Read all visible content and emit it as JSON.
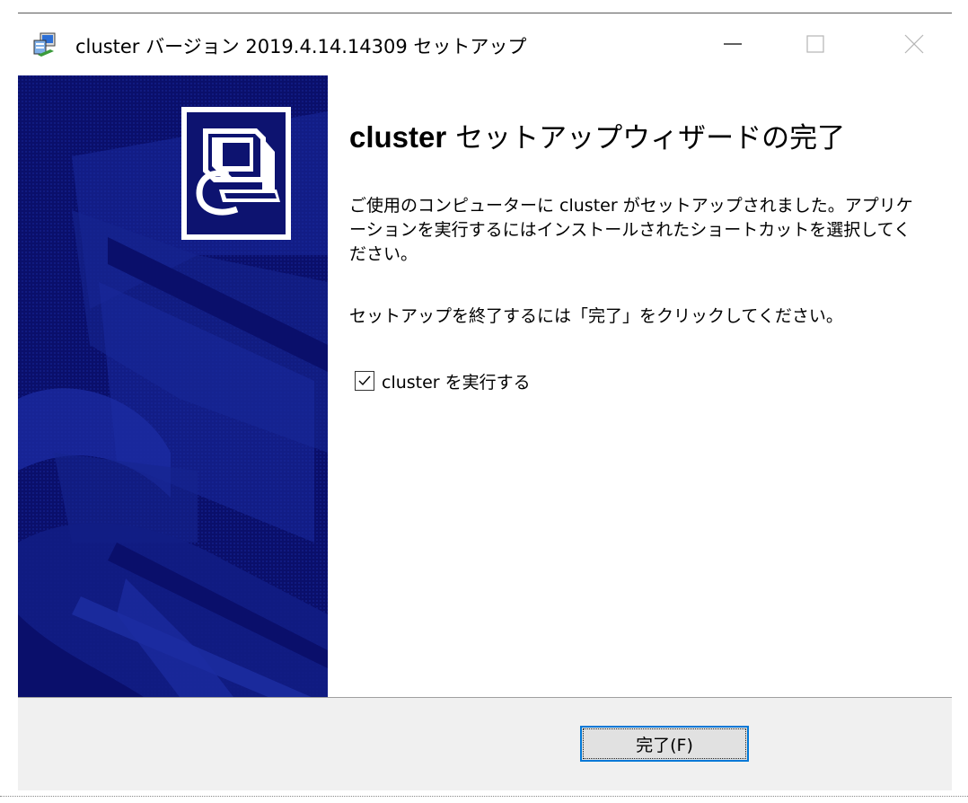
{
  "window": {
    "title": "cluster バージョン 2019.4.14.14309 セットアップ",
    "icon": "installer-icon",
    "controls": {
      "minimize": "minimize-icon",
      "maximize": "maximize-icon",
      "close": "close-icon"
    }
  },
  "colors": {
    "sidebar_bg": "#0a0f6b",
    "sidebar_accent": "#1a2a9c",
    "button_focus": "#0078d7",
    "footer_bg": "#f0f0f0"
  },
  "content": {
    "heading_bold": "cluster",
    "heading_rest": " セットアップウィザードの完了",
    "paragraph1": "ご使用のコンピューターに cluster がセットアップされました。アプリケ ーションを実行するにはインストールされたショートカットを選択してください。",
    "paragraph2": "セットアップを終了するには「完了」をクリックしてください。",
    "run_checkbox": {
      "label": "cluster を実行する",
      "checked": true
    }
  },
  "footer": {
    "finish_label": "完了(F)"
  }
}
